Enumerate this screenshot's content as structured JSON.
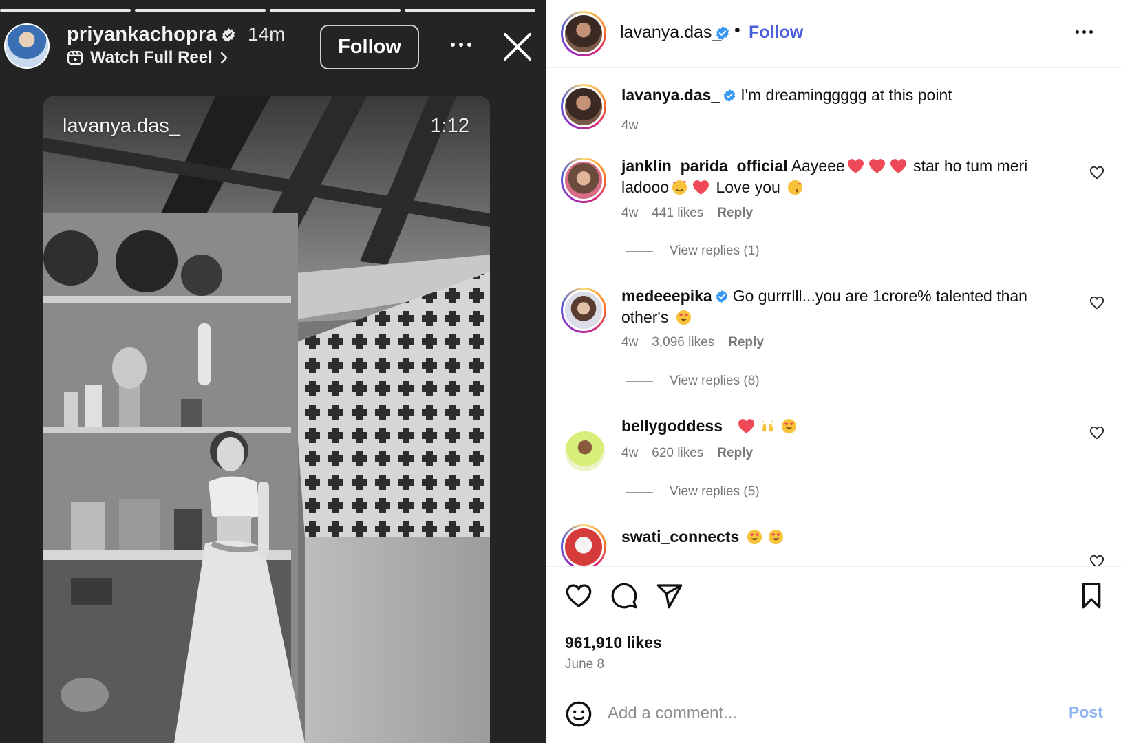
{
  "story": {
    "username": "priyankachopra",
    "time_ago": "14m",
    "watch_label": "Watch Full Reel",
    "follow_label": "Follow",
    "video": {
      "username": "lavanya.das_",
      "duration": "1:12"
    },
    "icons": [
      "verified-badge-icon",
      "reel-icon",
      "chevron-right-icon",
      "more-icon",
      "close-icon"
    ]
  },
  "post": {
    "header": {
      "username": "lavanya.das_",
      "separator": "•",
      "follow_label": "Follow"
    },
    "caption": {
      "username": "lavanya.das_",
      "text": "I'm dreaminggggg at this point",
      "time": "4w"
    },
    "comments": [
      {
        "username": "janklin_parida_official",
        "text_a": "Aayeee",
        "text_b": " star ho tum meri",
        "text_c": "ladooo",
        "text_d": " Love you ",
        "time": "4w",
        "likes": "441 likes",
        "reply": "Reply",
        "view_replies": "View replies (1)"
      },
      {
        "username": "medeeepika",
        "text_a": "Go gurrrlll...you are 1crore% talented than",
        "text_b": "other's ",
        "time": "4w",
        "likes": "3,096 likes",
        "reply": "Reply",
        "view_replies": "View replies (8)"
      },
      {
        "username": "bellygoddess_",
        "time": "4w",
        "likes": "620 likes",
        "reply": "Reply",
        "view_replies": "View replies (5)"
      },
      {
        "username": "swati_connects"
      }
    ],
    "likes_total": "961,910 likes",
    "date": "June 8",
    "composer": {
      "placeholder": "Add a comment...",
      "post_label": "Post"
    },
    "colors": {
      "link_blue": "#4a5ddb",
      "verified_blue": "#3897f0",
      "heart_red": "#ed4956"
    }
  }
}
